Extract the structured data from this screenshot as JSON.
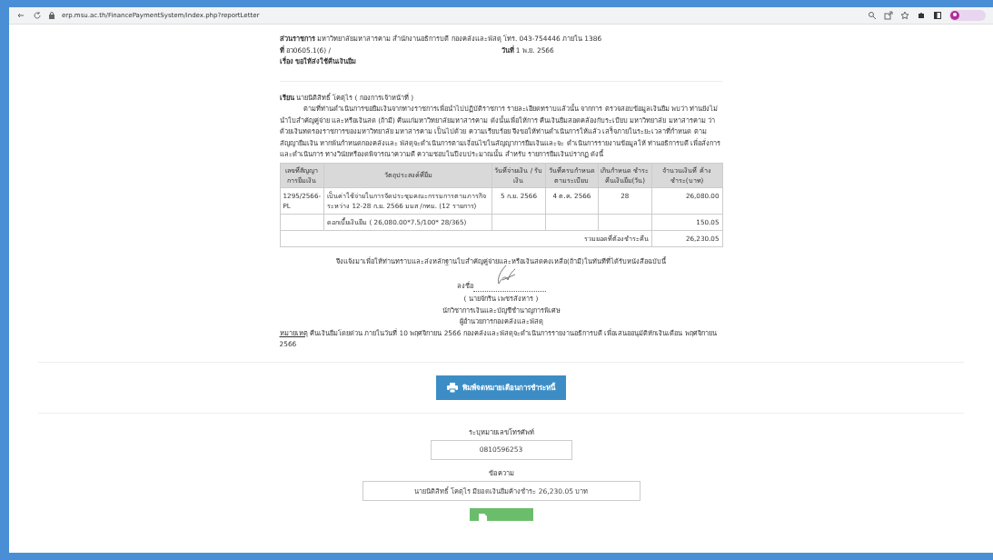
{
  "browser": {
    "url": "erp.msu.ac.th/FinancePaymentSystem/index.php?reportLetter"
  },
  "letter": {
    "header": [
      {
        "kind": "line",
        "text": "**ส่วนราชการ** มหาวิทยาลัยมหาสารคาม สำนักงานอธิการบดี กองคลังและพัสดุ โทร. 043-754446 ภายใน 1386"
      },
      {
        "kind": "pair",
        "text": "**ที่** อว0605.1(6) /",
        "right": "**วันที่** 1 พ.ย. 2566"
      },
      {
        "kind": "line",
        "text": "**เรื่อง ขอให้ส่งใช้คืนเงินยืม**"
      }
    ],
    "to": "**เรียน** นายนิติสิทธิ์ โคตุไร ( กองการเจ้าหน้าที่ )",
    "body": "ตามที่ท่านดำเนินการขอยืมเงินจากทางราชการเพื่อนำไปปฏิบัติราชการ รายละเอียดทราบแล้วนั้น จากการ ตรวจสอบข้อมูลเงินยืม พบว่า ท่านยังไม่นำใบสำคัญคู่จ่าย และหรือเงินสด (ถ้ามี) คืนแก่มหาวิทยาลัยมหาสารคาม ดังนั้นเพื่อให้การ คืนเงินยืมสอดคล้องกับระเบียบ มหาวิทยาลัย มหาสารคาม ว่าด้วยเงินทดรองราชการของมหาวิทยาลัย มหาสารคาม เป็นไปด้วย ความเรียบร้อย จึงขอให้ท่านดำเนินการให้แล้ว เสร็จภายในระยะเวลาที่กำหนด ตามสัญญายืมเงิน หากพ้นกำหนดกองคลังและ พัสดุจะดำเนินการตามเงื่อนไขในสัญญาการยืมเงินและจะ ดำเนินการรายงานข้อมูลให้ ท่านอธิการบดี เพื่อสั่งการและดำเนินการ ทางวินัยหรืองดพิจารณาความดี ความชอบในปีงบประมาณนั้น สำหรับ รายการยืมเงินปรากฏ ดังนี้",
    "table": {
      "columns": [
        "เลขที่สัญญา การยืมเงิน",
        "วัตถุประสงค์ที่ยืม",
        "วันที่จ่ายเงิน / รับเงิน",
        "วันที่ครบกำหนด ตามระเบียบ",
        "เกินกำหนด ชำระ คืนเงินยืม(วัน)",
        "จำนวนเงินที่ ค้างชำระ(บาท)"
      ],
      "rows": [
        [
          "1295/2566-PL",
          "เป็นค่าใช้จ่ายในการจัดประชุมคณะกรรมการตามภารกิจ ระหว่าง 12-28 ก.ย. 2566 มมส /กทม. (12 รายการ)",
          "5 ก.ย. 2566",
          "4 ต.ค. 2566",
          "28",
          "26,080.00"
        ],
        [
          "",
          "ดอกเบี้ยเงินยืม ( 26,080.00*7.5/100* 28/365)",
          "",
          "",
          "",
          "150.05"
        ]
      ],
      "total_label": "รวมยอดที่ต้องชำระคืน",
      "total": "26,230.05"
    },
    "closing": "จึงแจ้งมาเพื่อให้ท่านทราบและส่งหลักฐานใบสำคัญคู่จ่ายและหรือเงินสดคงเหลือ(ถ้ามี)ในทันทีที่ได้รับหนังสือฉบับนี้",
    "sign_label": "ลงชื่อ",
    "signer": [
      "( นายจักริน เพชรสังหาร )",
      "นักวิชาการเงินและบัญชีชำนาญการพิเศษ",
      "ผู้อำนวยการกองคลังและพัสดุ"
    ],
    "note_label": "หมายเหตุ",
    "note": "คืนเงินยืมโดยด่วน ภายในวันที่ 10 พฤศจิกายน 2566 กองคลังและพัสดุจะดำเนินการรายงานอธิการบดี เพื่อเสนออนุมัติหักเงินเดือน พฤศจิกายน 2566"
  },
  "print_button": "พิมพ์จดหมายเตือนการชำระหนี้",
  "form": {
    "fields": [
      {
        "label": "ระบุหมายเลขโทรศัพท์",
        "value": "0810596253",
        "kind": "narrow"
      },
      {
        "label": "ข้อความ",
        "value": "นายนิติสิทธิ์ โคตุไร มียอดเงินยืมค้างชำระ 26,230.05 บาท",
        "kind": "wide"
      }
    ]
  }
}
